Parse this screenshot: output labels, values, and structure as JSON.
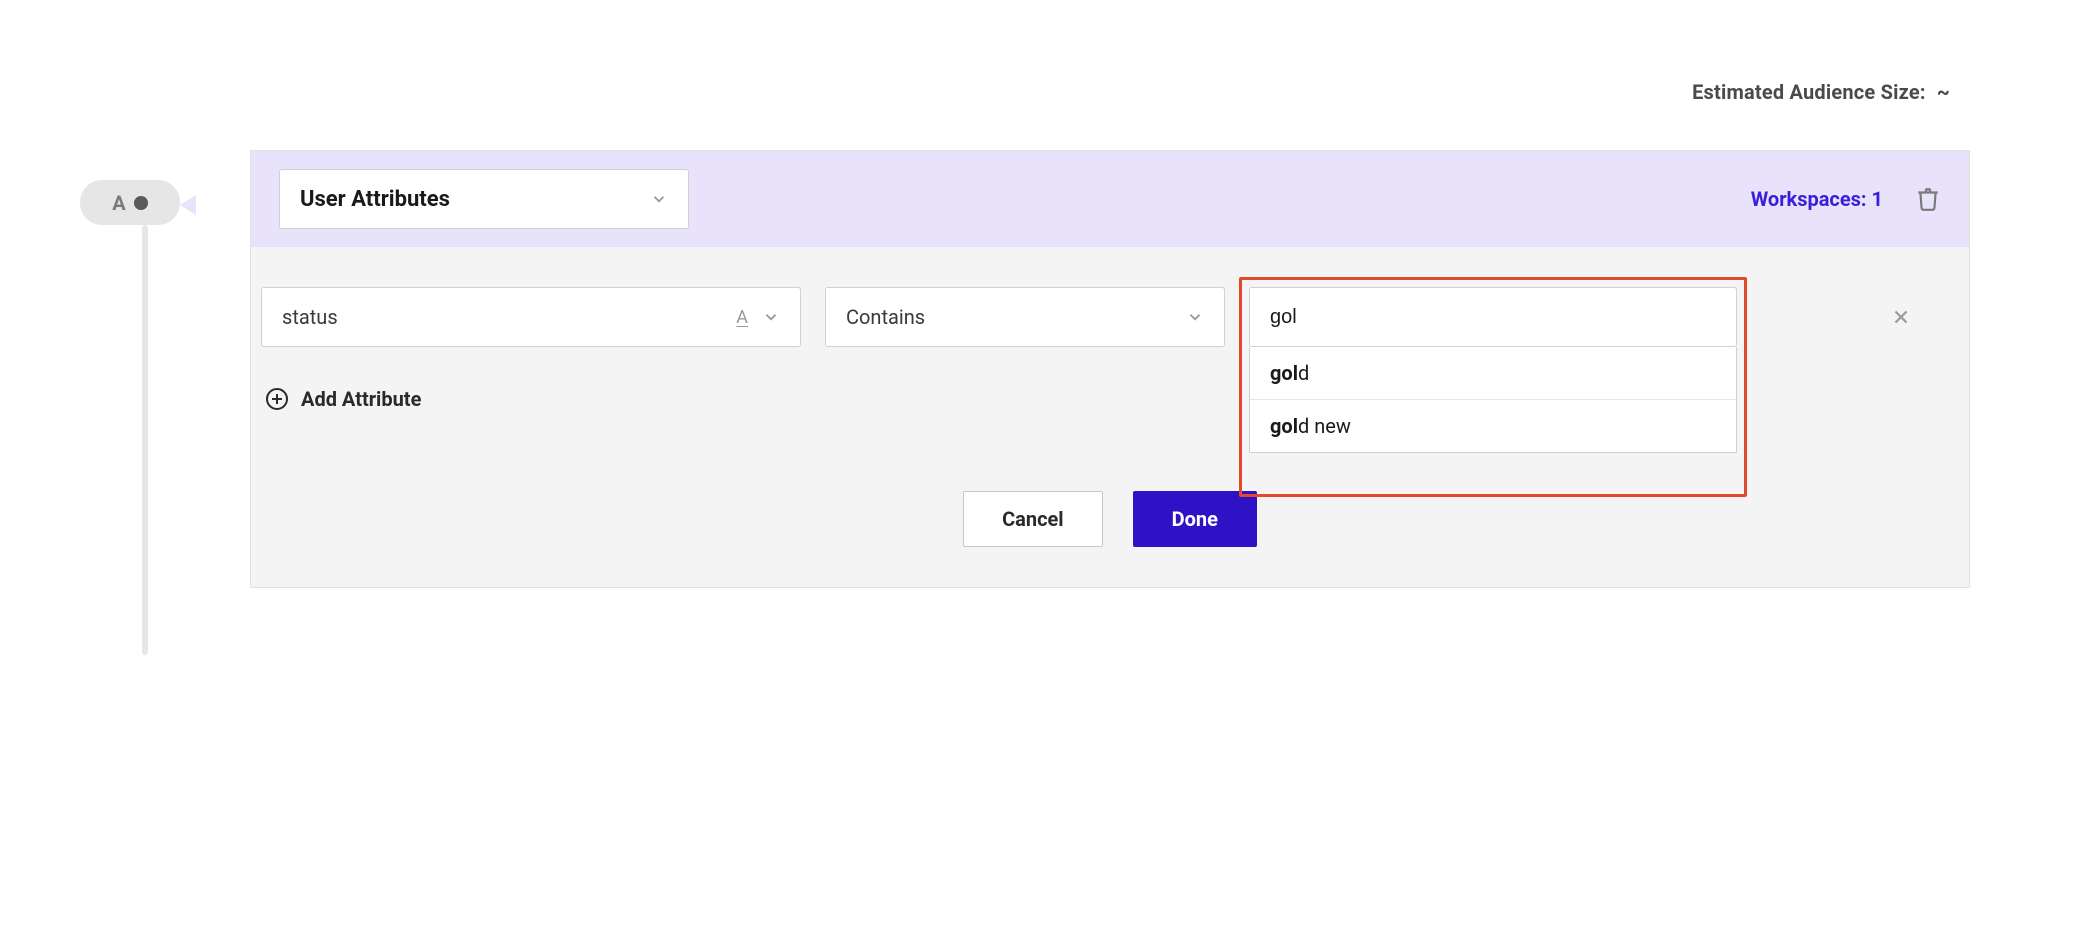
{
  "audience": {
    "label": "Estimated Audience Size:",
    "value": "~"
  },
  "node": {
    "letter": "A"
  },
  "header": {
    "segment_type": "User Attributes",
    "workspaces_label": "Workspaces: 1"
  },
  "criteria": {
    "attribute": "status",
    "operator": "Contains",
    "value": "gol",
    "suggestions": [
      {
        "match": "gol",
        "rest": "d"
      },
      {
        "match": "gol",
        "rest": "d new"
      }
    ]
  },
  "add_attribute_label": "Add Attribute",
  "buttons": {
    "cancel": "Cancel",
    "done": "Done"
  }
}
